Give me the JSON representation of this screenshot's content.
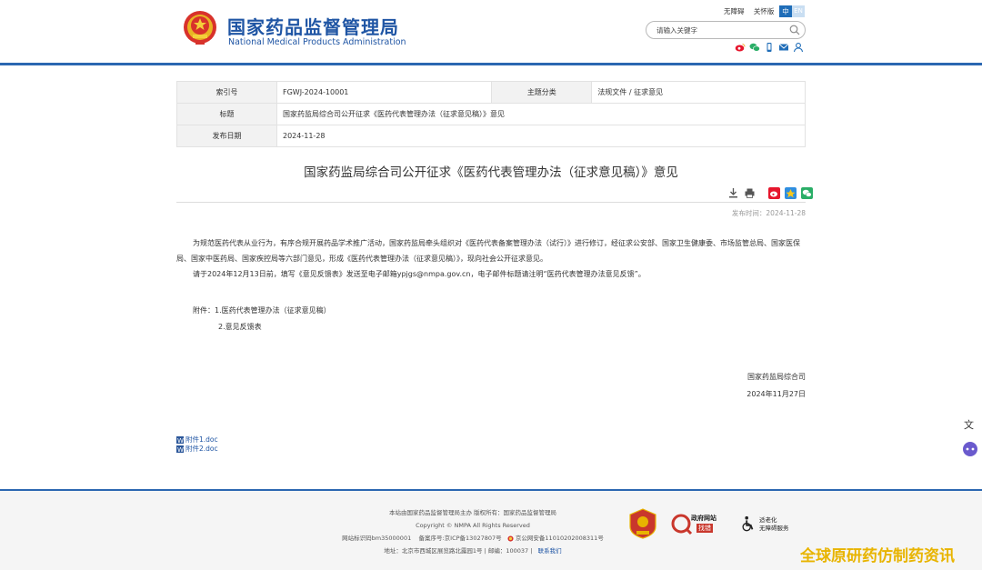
{
  "header": {
    "title": "国家药品监督管理局",
    "subtitle": "National Medical Products Administration",
    "accessibility_link": "无障碍",
    "care_mode_link": "关怀版",
    "lang_zh": "中",
    "lang_en": "EN",
    "search_placeholder": "请输入关键字",
    "share_icons": [
      "weibo-icon",
      "wechat-icon",
      "mobile-icon",
      "mail-icon",
      "user-icon"
    ]
  },
  "meta": {
    "index_label": "索引号",
    "index_value": "FGWJ-2024-10001",
    "category_label": "主题分类",
    "category_value": "法规文件 / 征求意见",
    "title_label": "标题",
    "title_value": "国家药监局综合司公开征求《医药代表管理办法（征求意见稿）》意见",
    "date_label": "发布日期",
    "date_value": "2024-11-28"
  },
  "article": {
    "title": "国家药监局综合司公开征求《医药代表管理办法（征求意见稿）》意见",
    "pub_time": "发布时间：2024-11-28",
    "paragraph_1": "为规范医药代表从业行为，有序合规开展药品学术推广活动，国家药监局牵头组织对《医药代表备案管理办法（试行）》进行修订，经征求公安部、国家卫生健康委、市场监管总局、国家医保局、国家中医药局、国家疾控局等六部门意见，形成《医药代表管理办法（征求意见稿）》，现向社会公开征求意见。",
    "paragraph_2": "请于2024年12月13日前，填写《意见反馈表》发送至电子邮箱ypjgs@nmpa.gov.cn，电子邮件标题请注明“医药代表管理办法意见反馈”。",
    "attachment_1": "附件：1.医药代表管理办法（征求意见稿）",
    "attachment_2": "2.意见反馈表",
    "signature_org": "国家药监局综合司",
    "signature_date": "2024年11月27日",
    "file_1": "附件1.doc",
    "file_2": "附件2.doc"
  },
  "footer": {
    "line_1": "本站由国家药品监督管理局主办 版权所有：国家药品监督管理局",
    "line_2": "Copyright © NMPA All Rights Reserved",
    "line_3a": "网站标识码bm35000001",
    "line_3b": "备案序号:京ICP备13027807号",
    "line_3c": "京公网安备11010202008311号",
    "line_4a": "地址：北京市西城区展览路北露园1号 | 邮编：100037 |",
    "line_4b": "联系我们",
    "badge_2_top": "政府网站",
    "badge_2_bottom": "找错",
    "badge_3_top": "适老化",
    "badge_3_bottom": "无障碍服务"
  },
  "watermark": "全球原研药仿制药资讯",
  "colors": {
    "brand_blue": "#1f55a4",
    "header_line": "#2b67b1",
    "watermark": "#e8b400"
  }
}
